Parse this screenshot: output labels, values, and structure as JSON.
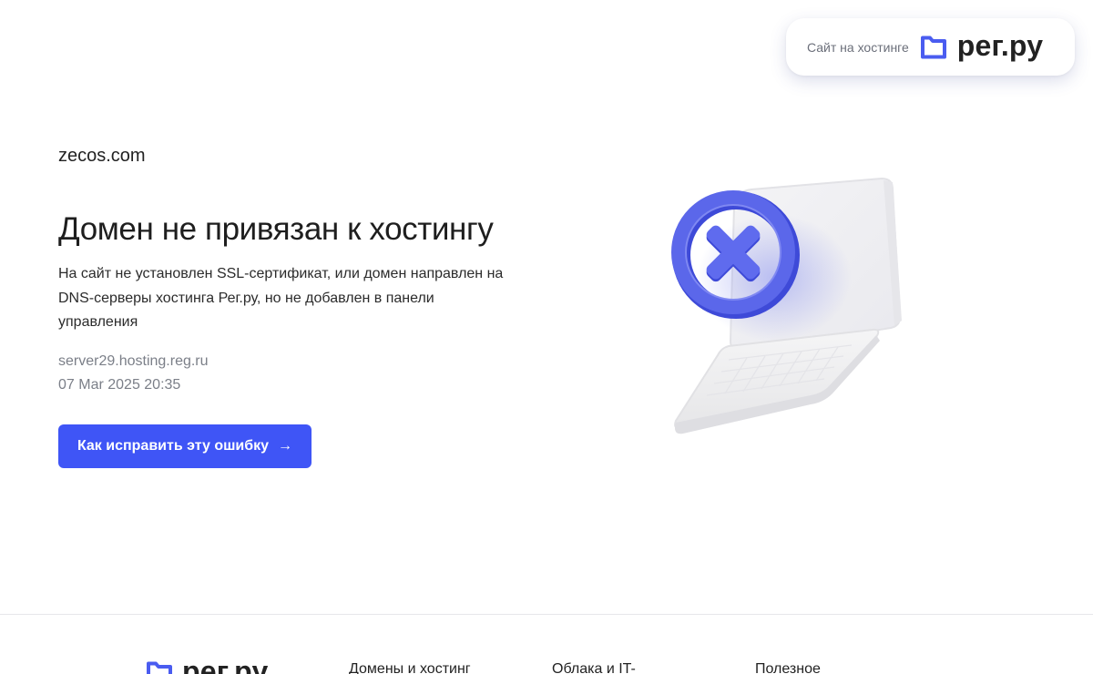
{
  "header": {
    "badge_text": "Сайт на хостинге",
    "logo_text": "рег.ру"
  },
  "main": {
    "domain": "zecos.com",
    "title": "Домен не привязан к хостингу",
    "description": "На сайт не установлен SSL-сертификат, или домен направлен на DNS-серверы хостинга Рег.ру, но не добавлен в панели управления",
    "server": "server29.hosting.reg.ru",
    "timestamp": "07 Mar 2025 20:35",
    "fix_button_label": "Как исправить эту ошибку",
    "fix_button_icon": "arrow-right-icon"
  },
  "footer": {
    "logo_text": "рег.ру",
    "columns": [
      "Домены и хостинг",
      "Облака и IT-",
      "Полезное"
    ]
  },
  "colors": {
    "accent": "#3f55f6",
    "logo_icon": "#4a5cf0",
    "illustration_ring": "#5b67ea"
  }
}
